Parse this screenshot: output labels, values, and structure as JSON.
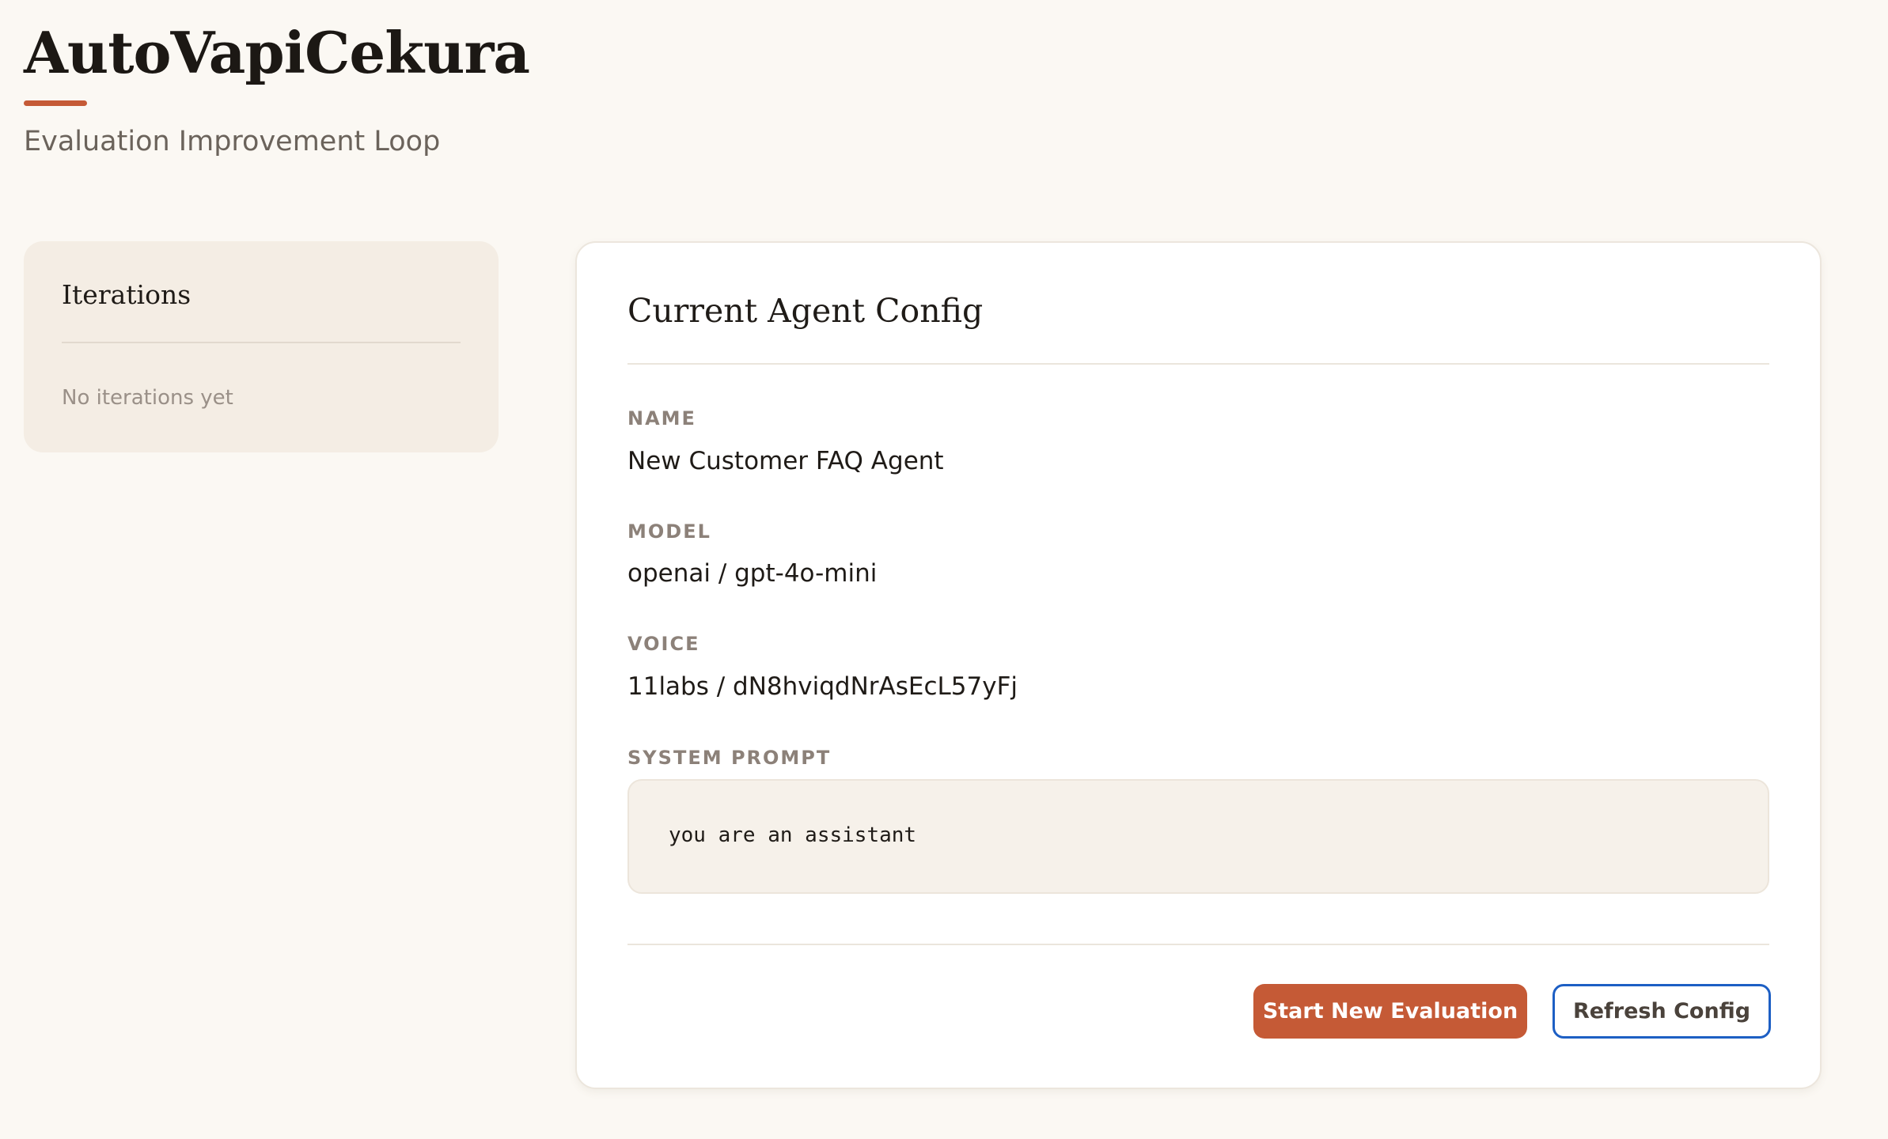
{
  "header": {
    "title": "AutoVapiCekura",
    "subtitle": "Evaluation Improvement Loop"
  },
  "iterations": {
    "title": "Iterations",
    "empty_text": "No iterations yet"
  },
  "config": {
    "title": "Current Agent Config",
    "name_label": "NAME",
    "name_value": "New Customer FAQ Agent",
    "model_label": "MODEL",
    "model_value": "openai / gpt-4o-mini",
    "voice_label": "VOICE",
    "voice_value": "11labs / dN8hviqdNrAsEcL57yFj",
    "system_prompt_label": "SYSTEM PROMPT",
    "system_prompt_value": "you are an assistant"
  },
  "actions": {
    "start_label": "Start New Evaluation",
    "refresh_label": "Refresh Config"
  },
  "colors": {
    "accent": "#c55a36",
    "background": "#fbf8f3",
    "panel": "#f4ede4",
    "focus_ring": "#1d5fc4"
  }
}
